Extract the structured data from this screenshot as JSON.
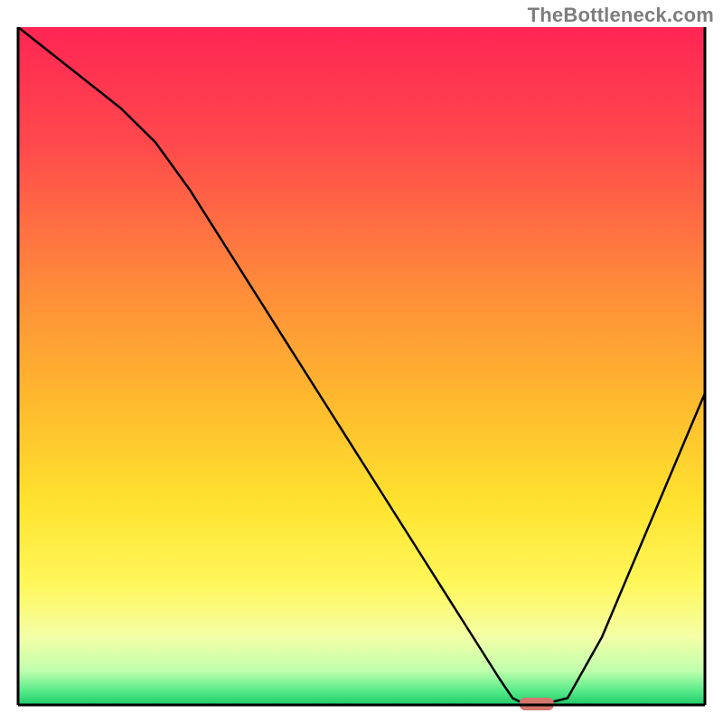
{
  "watermark": "TheBottleneck.com",
  "chart_data": {
    "type": "line",
    "title": "",
    "xlabel": "",
    "ylabel": "",
    "xlim": [
      0,
      100
    ],
    "ylim": [
      0,
      100
    ],
    "grid": false,
    "legend": false,
    "series": [
      {
        "name": "bottleneck-curve",
        "x": [
          0,
          5,
          10,
          15,
          20,
          25,
          30,
          35,
          40,
          45,
          50,
          55,
          60,
          65,
          70,
          72,
          74,
          76,
          80,
          85,
          90,
          95,
          100
        ],
        "y": [
          100,
          96,
          92,
          88,
          83,
          76,
          68,
          60,
          52,
          44,
          36,
          28,
          20,
          12,
          4,
          1,
          0,
          0,
          1,
          10,
          22,
          34,
          46
        ]
      }
    ],
    "marker": {
      "name": "optimal-marker",
      "x_range": [
        73,
        78
      ],
      "y": 0,
      "color": "#d6766e"
    },
    "gradient_stops": [
      {
        "pct": 0,
        "color": "#ff2554"
      },
      {
        "pct": 18,
        "color": "#ff4b4c"
      },
      {
        "pct": 38,
        "color": "#ff8a3a"
      },
      {
        "pct": 55,
        "color": "#ffb92e"
      },
      {
        "pct": 70,
        "color": "#ffe22e"
      },
      {
        "pct": 82,
        "color": "#fff75a"
      },
      {
        "pct": 90,
        "color": "#f4ffa6"
      },
      {
        "pct": 95,
        "color": "#bfffad"
      },
      {
        "pct": 98,
        "color": "#55ea88"
      },
      {
        "pct": 100,
        "color": "#1fca69"
      }
    ],
    "axes": {
      "frame_color": "#000000",
      "frame_width": 3
    }
  }
}
